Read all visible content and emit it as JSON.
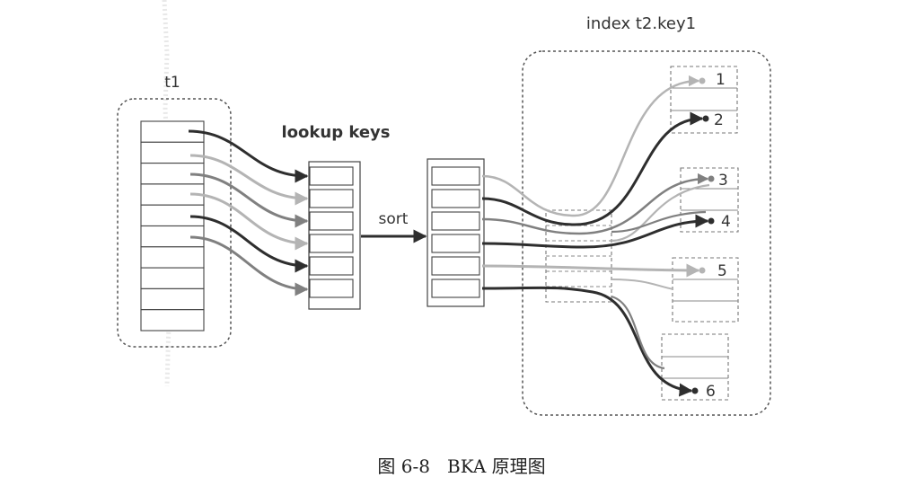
{
  "labels": {
    "table_t1": "t1",
    "lookup_keys": "lookup keys",
    "sort": "sort",
    "index": "index t2.key1"
  },
  "index_keys": [
    "1",
    "2",
    "3",
    "4",
    "5",
    "6"
  ],
  "caption": "图 6-8   BKA 原理图",
  "colors": {
    "dark": "#2e2e2e",
    "mid": "#808080",
    "light": "#b4b4b4",
    "box_stroke": "#444444",
    "dashed_border": "#555555"
  }
}
